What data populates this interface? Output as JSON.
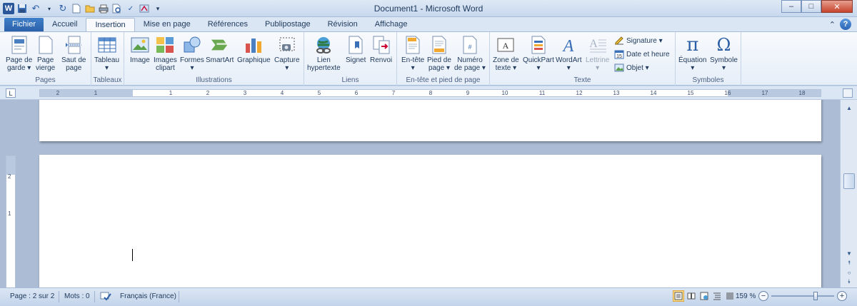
{
  "window": {
    "title": "Document1 - Microsoft Word",
    "minimize": "–",
    "maximize": "□",
    "close": "✕"
  },
  "qat": {
    "app_icon": "W",
    "undo_icon": "↶",
    "redo_icon": "↻",
    "customize_icon": "▾"
  },
  "tabs": [
    {
      "label": "Fichier"
    },
    {
      "label": "Accueil"
    },
    {
      "label": "Insertion"
    },
    {
      "label": "Mise en page"
    },
    {
      "label": "Références"
    },
    {
      "label": "Publipostage"
    },
    {
      "label": "Révision"
    },
    {
      "label": "Affichage"
    }
  ],
  "help": {
    "collapse_icon": "⌃",
    "help_label": "?"
  },
  "groups": {
    "pages": {
      "label": "Pages",
      "buttons": [
        "Page de\ngarde ▾",
        "Page\nvierge",
        "Saut de\npage"
      ]
    },
    "tableaux": {
      "label": "Tableaux",
      "buttons": [
        "Tableau\n▾"
      ]
    },
    "illustrations": {
      "label": "Illustrations",
      "buttons": [
        "Image",
        "Images\nclipart",
        "Formes\n▾",
        "SmartArt",
        "Graphique",
        "Capture\n▾"
      ]
    },
    "liens": {
      "label": "Liens",
      "buttons": [
        "Lien\nhypertexte",
        "Signet",
        "Renvoi"
      ]
    },
    "entete": {
      "label": "En-tête et pied de page",
      "buttons": [
        "En-tête\n▾",
        "Pied de\npage ▾",
        "Numéro\nde page ▾"
      ]
    },
    "texte": {
      "label": "Texte",
      "buttons": [
        "Zone de\ntexte ▾",
        "QuickPart\n▾",
        "WordArt\n▾",
        "Lettrine\n▾"
      ],
      "small": [
        "Signature ▾",
        "Date et heure",
        "Objet ▾"
      ]
    },
    "symboles": {
      "label": "Symboles",
      "buttons": [
        "Équation\n▾",
        "Symbole\n▾"
      ],
      "equation_glyph": "π",
      "symbol_glyph": "Ω"
    }
  },
  "ruler": {
    "corner": "L",
    "ticks": [
      "2",
      "1",
      "1",
      "2",
      "3",
      "4",
      "5",
      "6",
      "7",
      "8",
      "9",
      "10",
      "11",
      "12",
      "13",
      "14",
      "15",
      "16",
      "17",
      "18"
    ]
  },
  "vruler": {
    "ticks": [
      "2",
      "1"
    ]
  },
  "status": {
    "page": "Page : 2 sur 2",
    "words": "Mots : 0",
    "language": "Français (France)",
    "zoom": "159 %",
    "zoom_minus": "−",
    "zoom_plus": "+",
    "zoom_level_fraction": 0.72
  },
  "scroll": {
    "up": "▲",
    "down": "▼",
    "prev": "⯭",
    "select": "○",
    "next": "⯯"
  }
}
